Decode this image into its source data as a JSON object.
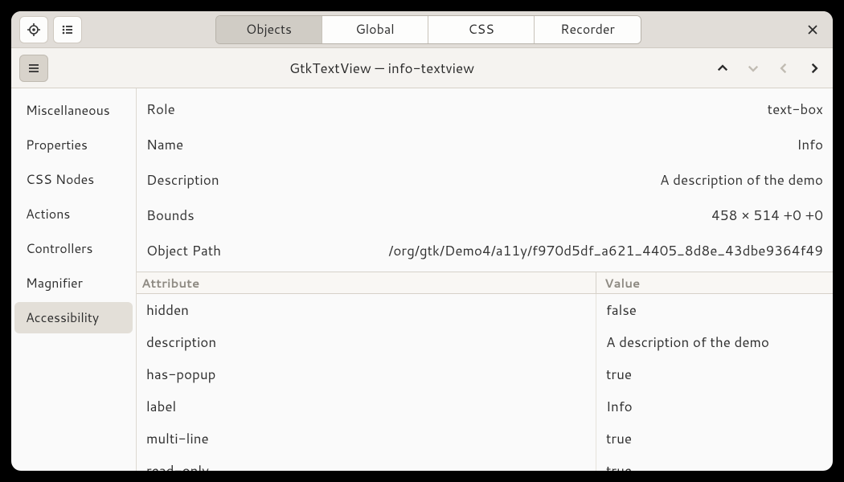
{
  "titlebar": {
    "tabs": [
      "Objects",
      "Global",
      "CSS",
      "Recorder"
    ],
    "active_tab": 0
  },
  "subbar": {
    "title": "GtkTextView — info-textview"
  },
  "sidebar": {
    "items": [
      "Miscellaneous",
      "Properties",
      "CSS Nodes",
      "Actions",
      "Controllers",
      "Magnifier",
      "Accessibility"
    ],
    "selected": 6
  },
  "props": [
    {
      "label": "Role",
      "value": "text-box"
    },
    {
      "label": "Name",
      "value": "Info"
    },
    {
      "label": "Description",
      "value": "A description of the demo"
    },
    {
      "label": "Bounds",
      "value": "458 × 514 +0 +0"
    },
    {
      "label": "Object Path",
      "value": "/org/gtk/Demo4/a11y/f970d5df_a621_4405_8d8e_43dbe9364f49"
    }
  ],
  "table": {
    "headers": {
      "attr": "Attribute",
      "val": "Value"
    },
    "rows": [
      {
        "attr": "hidden",
        "val": "false"
      },
      {
        "attr": "description",
        "val": "A description of the demo"
      },
      {
        "attr": "has-popup",
        "val": "true"
      },
      {
        "attr": "label",
        "val": "Info"
      },
      {
        "attr": "multi-line",
        "val": "true"
      },
      {
        "attr": "read-only",
        "val": "true"
      }
    ]
  }
}
